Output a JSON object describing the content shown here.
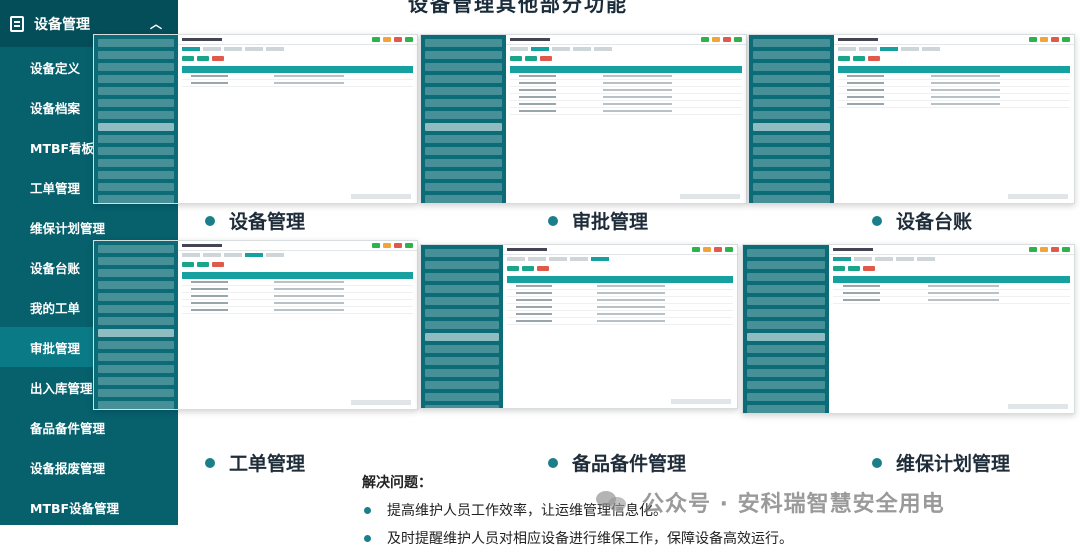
{
  "top_title": "设备管理其他部分功能",
  "sidebar": {
    "header": "设备管理",
    "items": [
      {
        "label": "设备定义"
      },
      {
        "label": "设备档案"
      },
      {
        "label": "MTBF看板"
      },
      {
        "label": "工单管理"
      },
      {
        "label": "维保计划管理"
      },
      {
        "label": "设备台账"
      },
      {
        "label": "我的工单"
      },
      {
        "label": "审批管理"
      },
      {
        "label": "出入库管理"
      },
      {
        "label": "备品备件管理"
      },
      {
        "label": "设备报废管理"
      },
      {
        "label": "MTBF设备管理"
      }
    ]
  },
  "captions": {
    "c1": "设备管理",
    "c2": "审批管理",
    "c3": "设备台账",
    "c4": "工单管理",
    "c5": "备品备件管理",
    "c6": "维保计划管理"
  },
  "solve": {
    "title": "解决问题：",
    "points": [
      "提高维护人员工作效率，让运维管理信息化。",
      "及时提醒维护人员对相应设备进行维保工作，保障设备高效运行。"
    ]
  },
  "watermark": "公众号 · 安科瑞智慧安全用电",
  "colors": {
    "sidebar": "#06616d",
    "accent": "#16a0a0",
    "dot": "#1a7f8a"
  }
}
